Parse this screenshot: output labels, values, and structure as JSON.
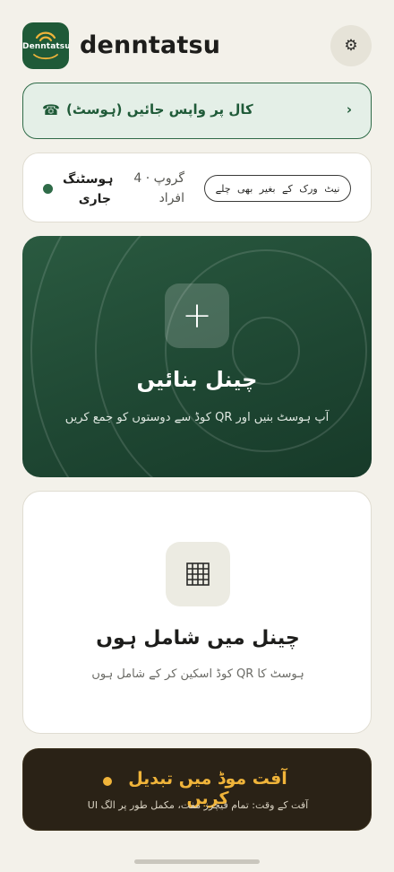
{
  "header": {
    "logo_text": "Denntatsu",
    "app_title": "denntatsu",
    "settings_icon": "⚙"
  },
  "return_call": {
    "icon": "☎",
    "label": "کال پر واپس جائیں (ہوسٹ)",
    "chevron": "›"
  },
  "status": {
    "hosting_label": "ہوسٹنگ جاری",
    "group_label": "گروپ · 4 افراد",
    "offline_pill": "نیٹ ورک کے بغیر بھی چلے",
    "dot_color": "#2f6b48"
  },
  "create_channel": {
    "icon": "+",
    "title": "چینل بنائیں",
    "subtitle": "آپ ہوسٹ بنیں اور QR کوڈ سے دوستوں کو جمع کریں"
  },
  "join_channel": {
    "icon": "qr-grid-icon",
    "title": "چینل میں شامل ہوں",
    "subtitle": "ہوسٹ کا QR کوڈ اسکین کر کے شامل ہوں"
  },
  "emergency": {
    "title": "آفت موڈ میں تبدیل کریں",
    "subtitle": "آفت کے وقت: تمام فیچرز مفت، مکمل طور پر الگ UI",
    "accent": "#f0b43a"
  },
  "colors": {
    "background": "#f3f1ea",
    "brand_green": "#1f5a38",
    "card_dark": "#1e4632",
    "emergency_bg": "#2a2216"
  }
}
